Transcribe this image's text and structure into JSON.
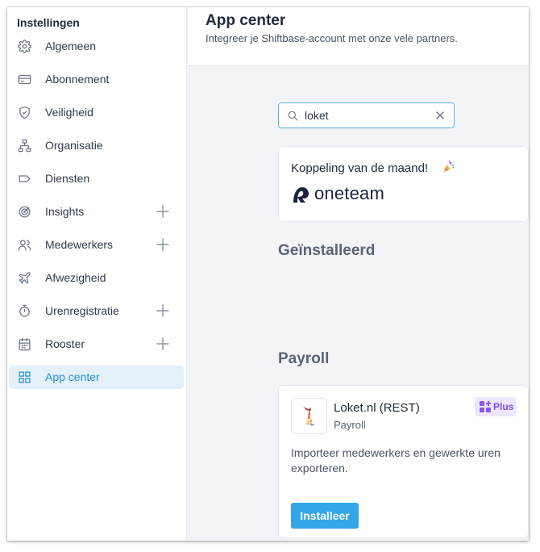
{
  "sidebar": {
    "title": "Instellingen",
    "items": [
      {
        "label": "Algemeen",
        "icon": "gear-icon",
        "expandable": false
      },
      {
        "label": "Abonnement",
        "icon": "credit-card-icon",
        "expandable": false
      },
      {
        "label": "Veiligheid",
        "icon": "shield-icon",
        "expandable": false
      },
      {
        "label": "Organisatie",
        "icon": "org-chart-icon",
        "expandable": false
      },
      {
        "label": "Diensten",
        "icon": "tag-icon",
        "expandable": false
      },
      {
        "label": "Insights",
        "icon": "target-icon",
        "expandable": true
      },
      {
        "label": "Medewerkers",
        "icon": "users-icon",
        "expandable": true
      },
      {
        "label": "Afwezigheid",
        "icon": "plane-icon",
        "expandable": false
      },
      {
        "label": "Urenregistratie",
        "icon": "stopwatch-icon",
        "expandable": true
      },
      {
        "label": "Rooster",
        "icon": "calendar-icon",
        "expandable": true
      },
      {
        "label": "App center",
        "icon": "grid-icon",
        "expandable": false,
        "active": true
      }
    ]
  },
  "header": {
    "title": "App center",
    "subtitle": "Integreer je Shiftbase-account met onze vele partners."
  },
  "search": {
    "value": "loket",
    "icon": "search-icon",
    "clear_icon": "close-icon"
  },
  "featured": {
    "title": "Koppeling van de maand!",
    "icon": "party-popper-icon",
    "partner_logo_text": "oneteam"
  },
  "sections": {
    "installed": "Geïnstalleerd",
    "payroll": "Payroll"
  },
  "app_card": {
    "name": "Loket.nl (REST)",
    "category": "Payroll",
    "badge": "Plus",
    "description": "Importeer medewerkers en gewerkte uren exporteren.",
    "install_label": "Installeer"
  },
  "colors": {
    "accent": "#33a6e6",
    "active_bg": "#e4f1fb",
    "plus_badge": "#7a4ee0"
  }
}
